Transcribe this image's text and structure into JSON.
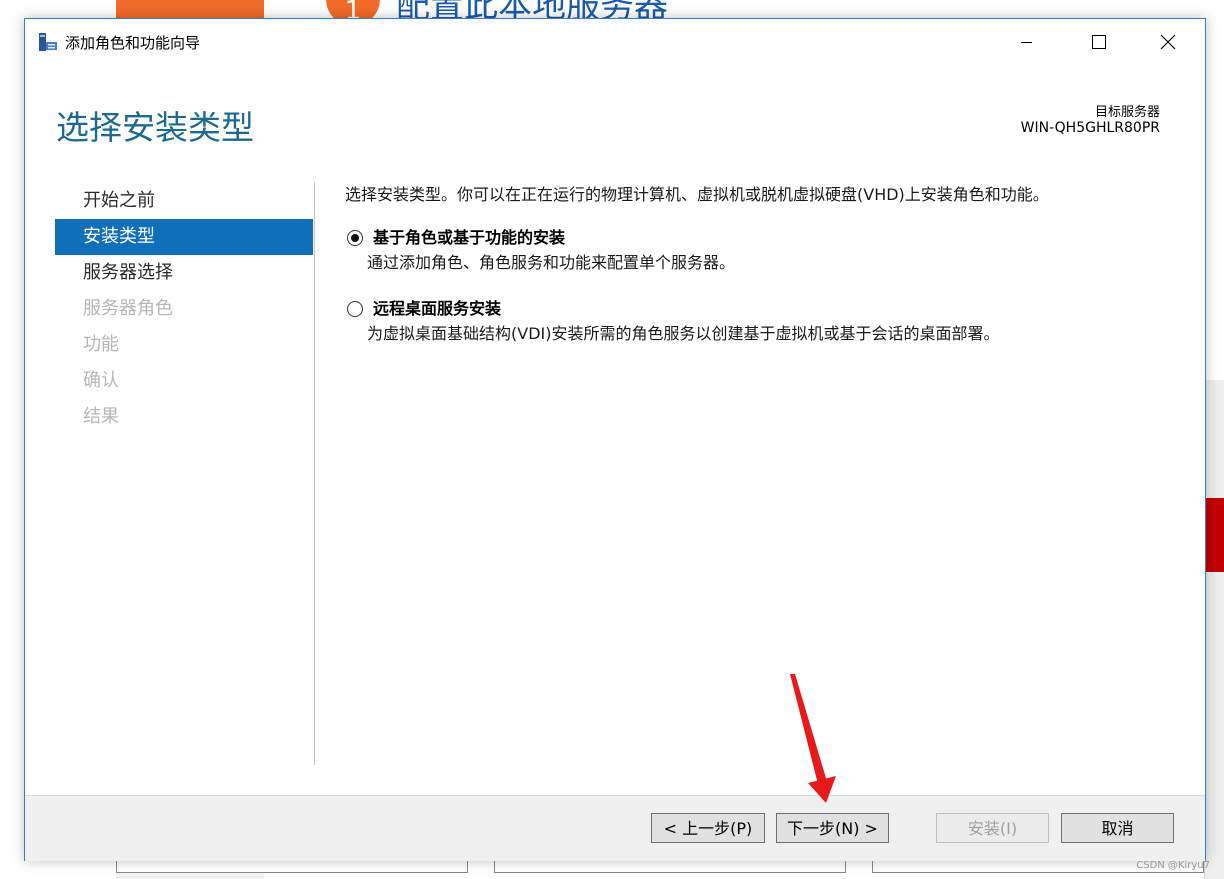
{
  "background": {
    "step_number": "1",
    "heading": "配置此本地服务器"
  },
  "dialog": {
    "title": "添加角色和功能向导",
    "page_title": "选择安装类型",
    "target_server_label": "目标服务器",
    "target_server_name": "WIN-QH5GHLR80PR"
  },
  "nav": {
    "items": [
      {
        "label": "开始之前",
        "state": "normal"
      },
      {
        "label": "安装类型",
        "state": "active"
      },
      {
        "label": "服务器选择",
        "state": "normal"
      },
      {
        "label": "服务器角色",
        "state": "disabled"
      },
      {
        "label": "功能",
        "state": "disabled"
      },
      {
        "label": "确认",
        "state": "disabled"
      },
      {
        "label": "结果",
        "state": "disabled"
      }
    ]
  },
  "content": {
    "description": "选择安装类型。你可以在正在运行的物理计算机、虚拟机或脱机虚拟硬盘(VHD)上安装角色和功能。",
    "options": [
      {
        "title": "基于角色或基于功能的安装",
        "description": "通过添加角色、角色服务和功能来配置单个服务器。",
        "selected": true
      },
      {
        "title": "远程桌面服务安装",
        "description": "为虚拟桌面基础结构(VDI)安装所需的角色服务以创建基于虚拟机或基于会话的桌面部署。",
        "selected": false
      }
    ]
  },
  "footer": {
    "prev_label": "< 上一步(P)",
    "next_label": "下一步(N) >",
    "install_label": "安装(I)",
    "cancel_label": "取消"
  },
  "watermark": "CSDN @Kiryu7",
  "colors": {
    "accent": "#0f6fb8",
    "title": "#1e6a8f",
    "annotation_arrow": "#e8191b",
    "bg_orange": "#f26b2a"
  }
}
